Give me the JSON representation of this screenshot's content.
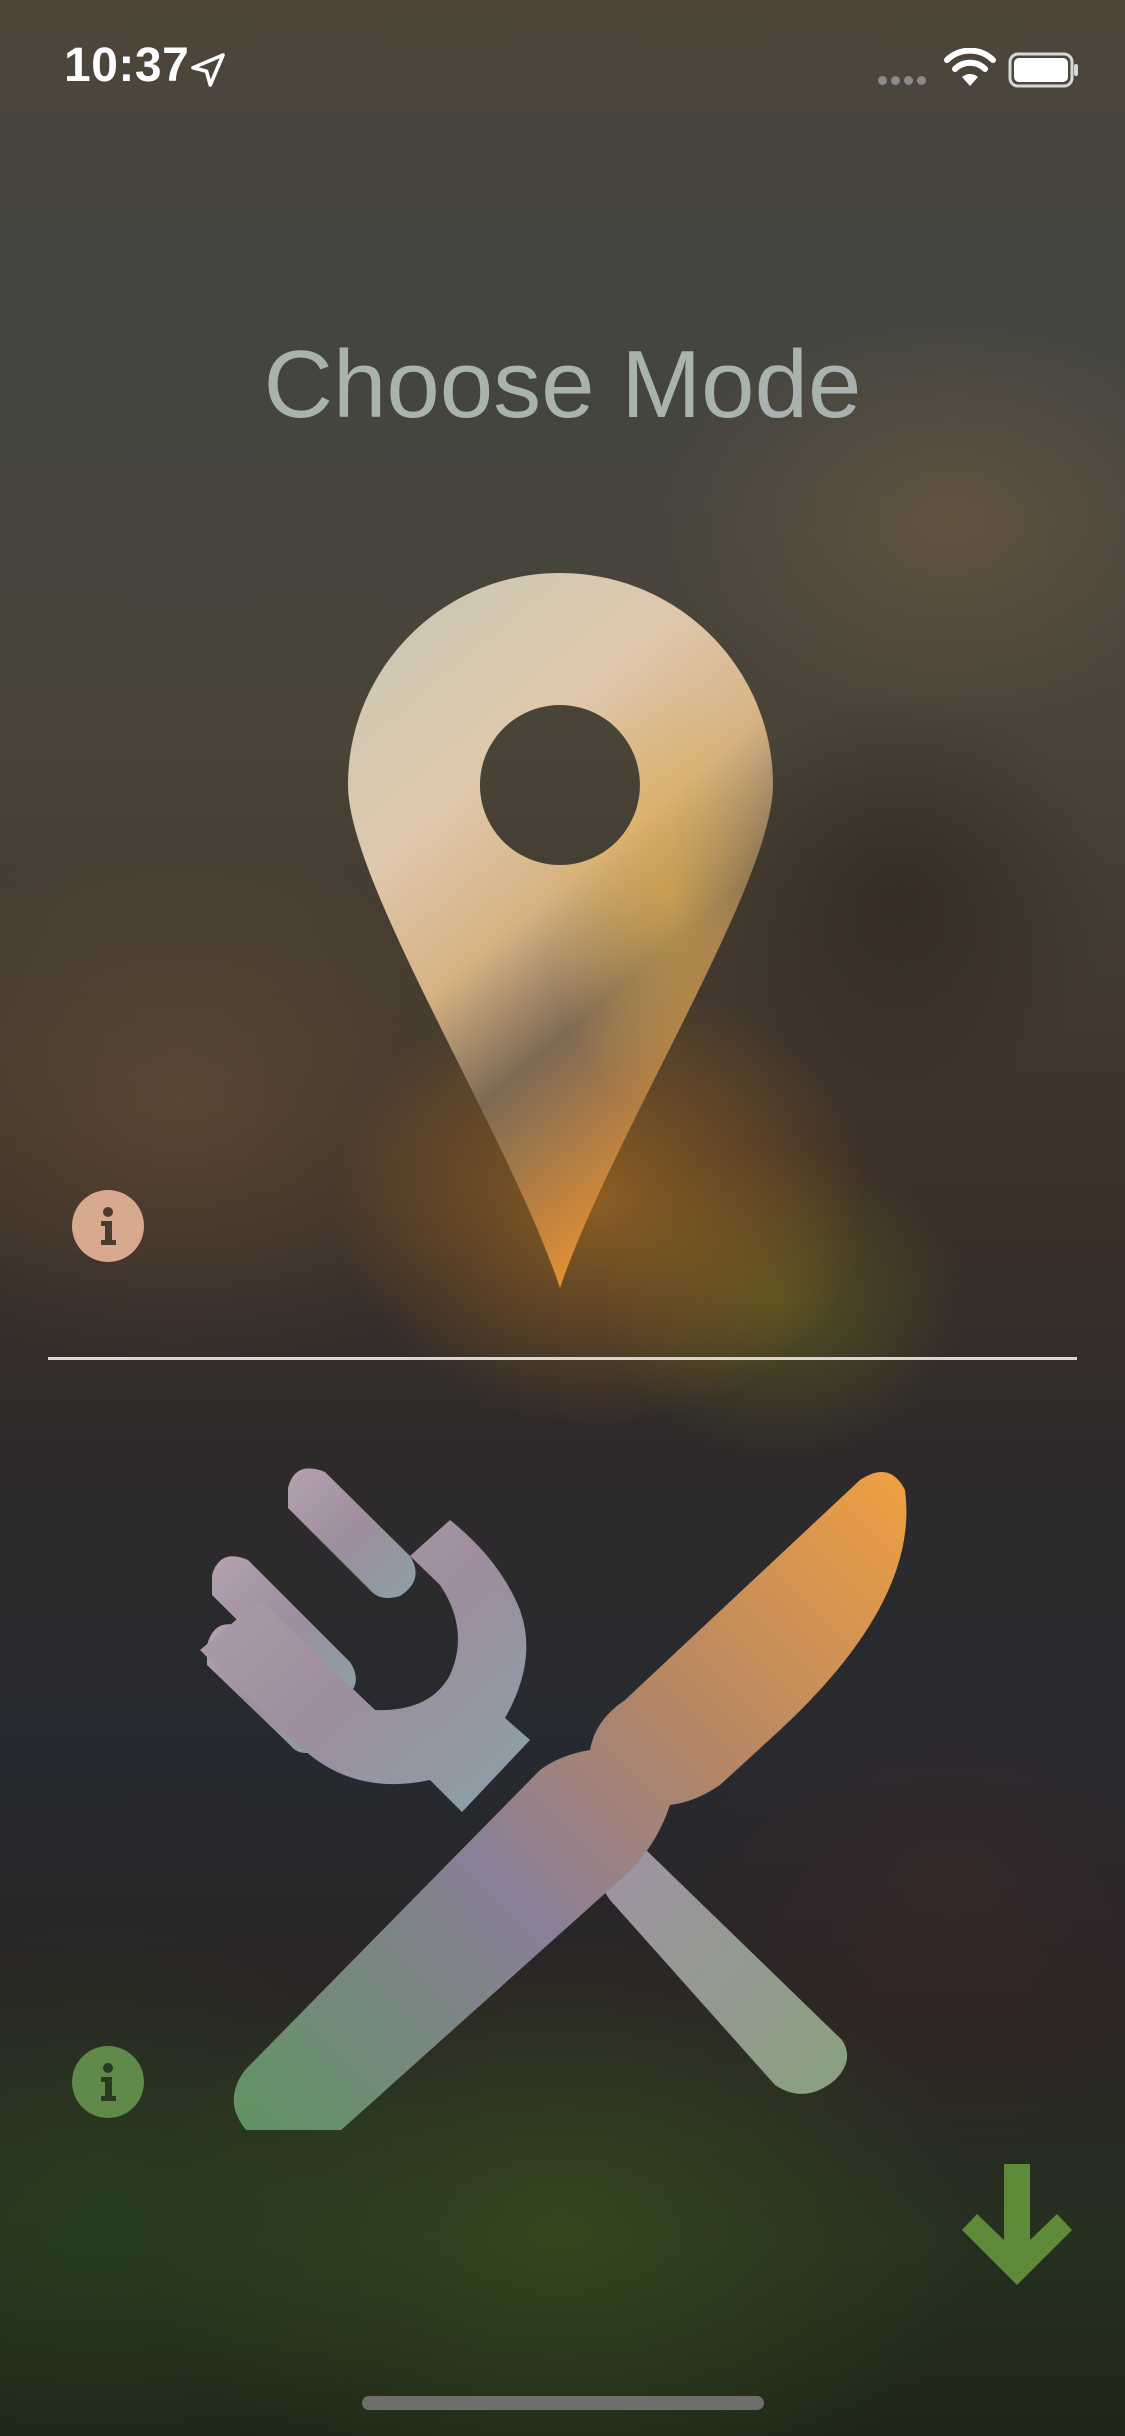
{
  "status_bar": {
    "time": "10:37",
    "icons": [
      "location-arrow-icon",
      "cellular-signal-icon",
      "wifi-icon",
      "battery-icon"
    ]
  },
  "screen": {
    "title": "Choose Mode"
  },
  "modes": [
    {
      "name": "location",
      "icon": "map-pin-icon",
      "info_icon": "info-icon",
      "info_color": "#d7a98f"
    },
    {
      "name": "food",
      "icon": "fork-knife-icon",
      "info_icon": "info-icon",
      "info_color": "#5f8a49"
    }
  ],
  "actions": {
    "next_icon": "arrow-down-icon",
    "next_color": "#5e8a3a"
  },
  "colors": {
    "title": "#a9b3ae",
    "divider": "#d9d6d0"
  }
}
